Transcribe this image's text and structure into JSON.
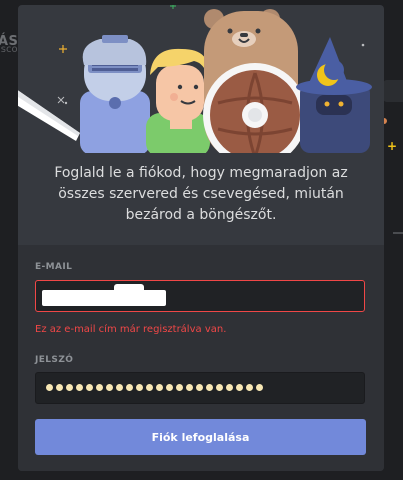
{
  "background": {
    "left_text": "ÁSA",
    "left_subtext": "isco"
  },
  "modal": {
    "intro": "Foglald le a fiókod, hogy megmaradjon az összes szervered és csevegésed, miután bezárod a böngészőt.",
    "email": {
      "label": "E-MAIL",
      "value_redacted": true,
      "error": "Ez az e-mail cím már regisztrálva van."
    },
    "password": {
      "label": "JELSZÓ",
      "mask_length": 22
    },
    "submit_label": "Fiók lefoglalása"
  },
  "colors": {
    "modal_bg": "#36393f",
    "form_bg": "#2f3136",
    "input_bg": "#202225",
    "error": "#f04747",
    "accent": "#7289da"
  },
  "icons": [
    "knight-illustration",
    "blonde-character-illustration",
    "bear-illustration",
    "shield-illustration",
    "wizard-illustration",
    "moon-icon",
    "sword-illustration"
  ]
}
